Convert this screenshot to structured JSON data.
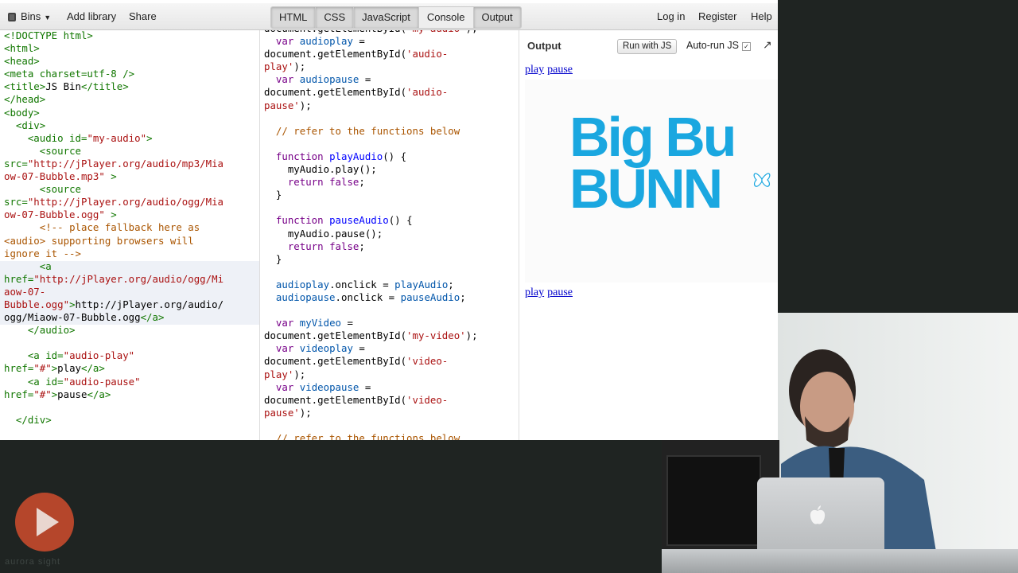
{
  "toolbar": {
    "bins_label": "Bins",
    "add_library_label": "Add library",
    "share_label": "Share",
    "tabs": [
      "HTML",
      "CSS",
      "JavaScript",
      "Console",
      "Output"
    ],
    "login_label": "Log in",
    "register_label": "Register",
    "help_label": "Help"
  },
  "output": {
    "title": "Output",
    "run_label": "Run with JS",
    "autorun_label": "Auto-run JS",
    "autorun_checked": "✓",
    "link_play": "play",
    "link_pause": "pause",
    "logo_line1": "Big Bu",
    "logo_line2": "BUNN"
  },
  "colors": {
    "accent_link": "#0000cc",
    "logo_blue": "#1aa7e0",
    "html_tag": "#117700",
    "string": "#aa1111",
    "keyword": "#770088"
  },
  "icons": {
    "bins": "bins-icon",
    "popout": "popout-arrow-icon",
    "play": "play-button-icon",
    "apple": "apple-logo-icon",
    "butterfly": "butterfly-icon"
  },
  "watermark": "aurora sight"
}
